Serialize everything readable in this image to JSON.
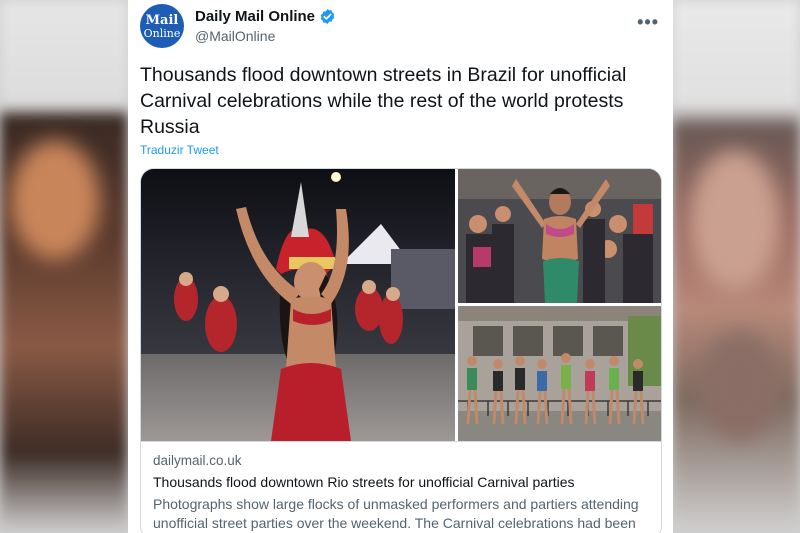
{
  "tweet": {
    "account": {
      "display_name": "Daily Mail Online",
      "handle": "@MailOnline",
      "avatar_line1": "Mail",
      "avatar_line2": "Online",
      "verified": true
    },
    "more_label": "•••",
    "text": "Thousands flood downtown streets in Brazil for unofficial Carnival celebrations while the rest of the world protests Russia",
    "translate_label": "Traduzir Tweet",
    "link_card": {
      "domain": "dailymail.co.uk",
      "title": "Thousands flood downtown Rio streets for unofficial Carnival parties",
      "description": "Photographs show large flocks of unmasked performers and partiers attending unofficial street parties over the weekend. The Carnival celebrations had been ..."
    }
  },
  "colors": {
    "accent": "#1d9bf0",
    "avatar_bg": "#1d5db5",
    "text_primary": "#0f1419",
    "text_secondary": "#536471"
  }
}
